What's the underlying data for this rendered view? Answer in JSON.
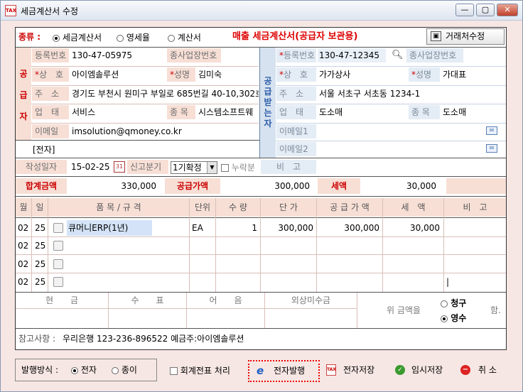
{
  "window": {
    "title": "세금계산서 수정",
    "icon": "tax-document-icon"
  },
  "type_row": {
    "label": "종류 :",
    "options": [
      "세금계산서",
      "영세율",
      "계산서"
    ],
    "selected": 0,
    "banner": "매출 세금계산서(공급자 보관용)",
    "vendor_button": "거래처수정"
  },
  "supplier": {
    "side_label": [
      "공",
      "급",
      "자"
    ],
    "reg_no_label": "등록번호",
    "reg_no": "130-47-05975",
    "biz_label": "종사업장번호",
    "biz_no": "",
    "name_label": "상　호",
    "name": "아이엠솔루션",
    "rep_label": "성명",
    "rep": "김미숙",
    "addr_label": "주　소",
    "addr": "경기도 부천시 원미구 부일로 685번길 40-10,302호",
    "cond_label": "업　태",
    "cond": "서비스",
    "item_label": "종 목",
    "item": "시스템소프트웨",
    "email_label": "이메일",
    "email": "imsolution@qmoney.co.kr"
  },
  "buyer": {
    "side_label": [
      "공",
      "급",
      "받",
      "는",
      "자"
    ],
    "reg_no_label": "등록번호",
    "reg_no": "130-47-12345",
    "biz_label": "종사업장번호",
    "biz_no": "",
    "name_label": "상　호",
    "name": "가가상사",
    "rep_label": "성명",
    "rep": "가대표",
    "addr_label": "주　소",
    "addr": "서울 서초구 서초동 1234-1",
    "cond_label": "업　태",
    "cond": "도소매",
    "item_label": "종 목",
    "item": "도소매",
    "email1_label": "이메일1",
    "email1": "",
    "email2_label": "이메일2",
    "email2": ""
  },
  "electronic_tag": "[전자]",
  "date_row": {
    "date_label": "작성일자",
    "date": "15-02-25",
    "period_label": "신고분기",
    "period": "1기확정",
    "omit_label": "누락분",
    "remark_label": "비　고"
  },
  "totals": {
    "total_label": "합계금액",
    "total": "330,000",
    "supply_label": "공급가액",
    "supply": "300,000",
    "tax_label": "세액",
    "tax": "30,000"
  },
  "items_header": {
    "month": "월",
    "day": "일",
    "item": "품 목 / 규 격",
    "unit": "단위",
    "qty": "수 량",
    "price": "단 가",
    "supply": "공 급 가 액",
    "tax": "세　액",
    "remark": "비　고"
  },
  "items": [
    {
      "month": "02",
      "day": "25",
      "item": "큐머니ERP(1년)",
      "unit": "EA",
      "qty": "1",
      "price": "300,000",
      "supply": "300,000",
      "tax": "30,000",
      "remark": ""
    },
    {
      "month": "02",
      "day": "25",
      "item": "",
      "unit": "",
      "qty": "",
      "price": "",
      "supply": "",
      "tax": "",
      "remark": ""
    },
    {
      "month": "02",
      "day": "25",
      "item": "",
      "unit": "",
      "qty": "",
      "price": "",
      "supply": "",
      "tax": "",
      "remark": ""
    },
    {
      "month": "02",
      "day": "25",
      "item": "",
      "unit": "",
      "qty": "",
      "price": "",
      "supply": "",
      "tax": "",
      "remark": "|"
    }
  ],
  "payment": {
    "cash": "현　　금",
    "check": "수　　표",
    "bill": "어　　음",
    "credit": "외상미수금",
    "amount_label": "위 금액을",
    "claim": "청구",
    "receipt": "영수",
    "selected": "영수",
    "suffix": "함."
  },
  "note": {
    "label": "참고사항 :",
    "text": "우리은행 123-236-896522 예금주:아이엠솔루션"
  },
  "bottom": {
    "issue_label": "발행방식 :",
    "issue_options": [
      "전자",
      "종이"
    ],
    "issue_selected": 0,
    "voucher_label": "회계전표 처리",
    "e_issue": "전자발행",
    "e_save": "전자저장",
    "temp_save": "임시저장",
    "cancel": "취 소"
  },
  "colors": {
    "red_text": "#cc0000",
    "label_bg": "#f7dfd6",
    "buyer_bg": "#e4ecf5",
    "window_bg": "#f6e7e4"
  }
}
